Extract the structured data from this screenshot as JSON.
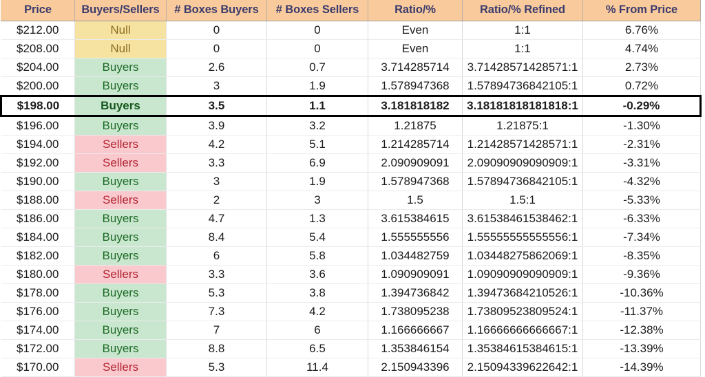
{
  "table": {
    "columns": [
      {
        "key": "price",
        "label": "Price"
      },
      {
        "key": "state",
        "label": "Buyers/Sellers"
      },
      {
        "key": "boxes_b",
        "label": "# Boxes Buyers"
      },
      {
        "key": "boxes_s",
        "label": "# Boxes Sellers"
      },
      {
        "key": "ratio",
        "label": "Ratio/%"
      },
      {
        "key": "refined",
        "label": "Ratio/% Refined"
      },
      {
        "key": "pct",
        "label": "% From Price"
      }
    ],
    "colors": {
      "header_bg": "#F9CB9C",
      "header_text": "#3B3B6D",
      "null_bg": "#F7E3A1",
      "null_text": "#8A6D1F",
      "buyers_bg": "#C9E7CE",
      "buyers_text": "#1E6B28",
      "sellers_bg": "#F9C9CE",
      "sellers_text": "#B32330",
      "highlight_border": "#000000",
      "gridline": "#E3E3E3"
    },
    "highlight_row_index": 4,
    "rows": [
      {
        "price": "$212.00",
        "state": "Null",
        "state_kind": "null",
        "boxes_b": "0",
        "boxes_s": "0",
        "ratio": "Even",
        "refined": "1:1",
        "pct": "6.76%"
      },
      {
        "price": "$208.00",
        "state": "Null",
        "state_kind": "null",
        "boxes_b": "0",
        "boxes_s": "0",
        "ratio": "Even",
        "refined": "1:1",
        "pct": "4.74%"
      },
      {
        "price": "$204.00",
        "state": "Buyers",
        "state_kind": "buyers",
        "boxes_b": "2.6",
        "boxes_s": "0.7",
        "ratio": "3.714285714",
        "refined": "3.71428571428571:1",
        "pct": "2.73%"
      },
      {
        "price": "$200.00",
        "state": "Buyers",
        "state_kind": "buyers",
        "boxes_b": "3",
        "boxes_s": "1.9",
        "ratio": "1.578947368",
        "refined": "1.57894736842105:1",
        "pct": "0.72%"
      },
      {
        "price": "$198.00",
        "state": "Buyers",
        "state_kind": "buyers",
        "boxes_b": "3.5",
        "boxes_s": "1.1",
        "ratio": "3.181818182",
        "refined": "3.18181818181818:1",
        "pct": "-0.29%"
      },
      {
        "price": "$196.00",
        "state": "Buyers",
        "state_kind": "buyers",
        "boxes_b": "3.9",
        "boxes_s": "3.2",
        "ratio": "1.21875",
        "refined": "1.21875:1",
        "pct": "-1.30%"
      },
      {
        "price": "$194.00",
        "state": "Sellers",
        "state_kind": "sellers",
        "boxes_b": "4.2",
        "boxes_s": "5.1",
        "ratio": "1.214285714",
        "refined": "1.21428571428571:1",
        "pct": "-2.31%"
      },
      {
        "price": "$192.00",
        "state": "Sellers",
        "state_kind": "sellers",
        "boxes_b": "3.3",
        "boxes_s": "6.9",
        "ratio": "2.090909091",
        "refined": "2.09090909090909:1",
        "pct": "-3.31%"
      },
      {
        "price": "$190.00",
        "state": "Buyers",
        "state_kind": "buyers",
        "boxes_b": "3",
        "boxes_s": "1.9",
        "ratio": "1.578947368",
        "refined": "1.57894736842105:1",
        "pct": "-4.32%"
      },
      {
        "price": "$188.00",
        "state": "Sellers",
        "state_kind": "sellers",
        "boxes_b": "2",
        "boxes_s": "3",
        "ratio": "1.5",
        "refined": "1.5:1",
        "pct": "-5.33%"
      },
      {
        "price": "$186.00",
        "state": "Buyers",
        "state_kind": "buyers",
        "boxes_b": "4.7",
        "boxes_s": "1.3",
        "ratio": "3.615384615",
        "refined": "3.61538461538462:1",
        "pct": "-6.33%"
      },
      {
        "price": "$184.00",
        "state": "Buyers",
        "state_kind": "buyers",
        "boxes_b": "8.4",
        "boxes_s": "5.4",
        "ratio": "1.555555556",
        "refined": "1.55555555555556:1",
        "pct": "-7.34%"
      },
      {
        "price": "$182.00",
        "state": "Buyers",
        "state_kind": "buyers",
        "boxes_b": "6",
        "boxes_s": "5.8",
        "ratio": "1.034482759",
        "refined": "1.03448275862069:1",
        "pct": "-8.35%"
      },
      {
        "price": "$180.00",
        "state": "Sellers",
        "state_kind": "sellers",
        "boxes_b": "3.3",
        "boxes_s": "3.6",
        "ratio": "1.090909091",
        "refined": "1.09090909090909:1",
        "pct": "-9.36%"
      },
      {
        "price": "$178.00",
        "state": "Buyers",
        "state_kind": "buyers",
        "boxes_b": "5.3",
        "boxes_s": "3.8",
        "ratio": "1.394736842",
        "refined": "1.39473684210526:1",
        "pct": "-10.36%"
      },
      {
        "price": "$176.00",
        "state": "Buyers",
        "state_kind": "buyers",
        "boxes_b": "7.3",
        "boxes_s": "4.2",
        "ratio": "1.738095238",
        "refined": "1.73809523809524:1",
        "pct": "-11.37%"
      },
      {
        "price": "$174.00",
        "state": "Buyers",
        "state_kind": "buyers",
        "boxes_b": "7",
        "boxes_s": "6",
        "ratio": "1.166666667",
        "refined": "1.16666666666667:1",
        "pct": "-12.38%"
      },
      {
        "price": "$172.00",
        "state": "Buyers",
        "state_kind": "buyers",
        "boxes_b": "8.8",
        "boxes_s": "6.5",
        "ratio": "1.353846154",
        "refined": "1.35384615384615:1",
        "pct": "-13.39%"
      },
      {
        "price": "$170.00",
        "state": "Sellers",
        "state_kind": "sellers",
        "boxes_b": "5.3",
        "boxes_s": "11.4",
        "ratio": "2.150943396",
        "refined": "2.15094339622642:1",
        "pct": "-14.39%"
      }
    ]
  }
}
